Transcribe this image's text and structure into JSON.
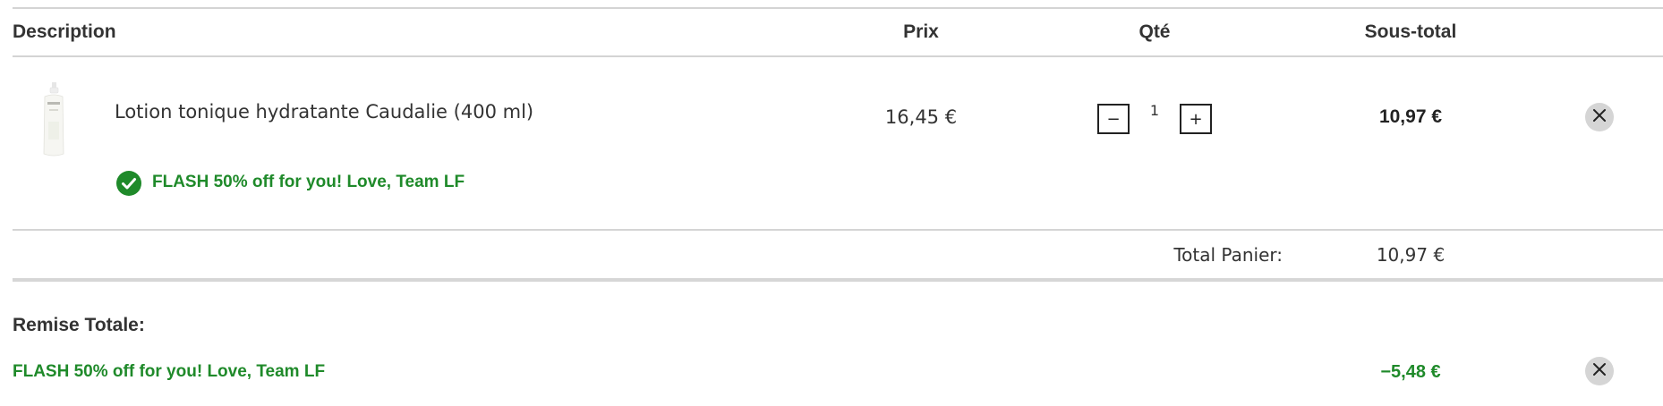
{
  "header": {
    "description": "Description",
    "prix": "Prix",
    "qte": "Qté",
    "sous_total": "Sous-total"
  },
  "item": {
    "name": "Lotion tonique hydratante Caudalie (400 ml)",
    "image_icon": "product-bottle-image",
    "price": "16,45 €",
    "qty_minus": "−",
    "qty": "1",
    "qty_plus": "+",
    "subtotal": "10,97 €",
    "remove_icon": "close-icon",
    "promo_icon": "check-circle-icon",
    "promo": "FLASH 50% off for you! Love, Team LF"
  },
  "totals": {
    "label": "Total Panier:",
    "value": "10,97 €"
  },
  "remise": {
    "label": "Remise Totale:",
    "promo": "FLASH 50% off for you! Love, Team LF",
    "value": "−5,48 €",
    "remove_icon": "close-icon"
  },
  "colors": {
    "promo_green": "#1f8a2a",
    "divider": "#d4d4d4",
    "remove_bg": "#d5d5d5"
  }
}
